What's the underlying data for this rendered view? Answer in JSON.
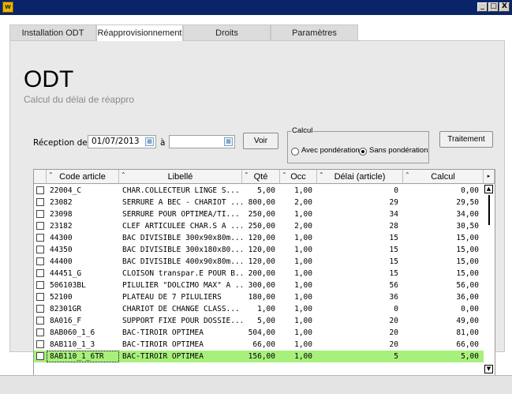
{
  "window": {
    "icon": "app-logo-icon",
    "icon_text": "W",
    "minimize": "_",
    "maximize": "□",
    "close": "X"
  },
  "tabs": [
    {
      "label": "Installation ODT",
      "active": false
    },
    {
      "label": "Réapprovisionnement",
      "active": true
    },
    {
      "label": "Droits",
      "active": false
    },
    {
      "label": "Paramètres",
      "active": false
    }
  ],
  "header": {
    "title": "ODT",
    "subtitle": "Calcul du délai de réappro"
  },
  "filters": {
    "reception_label": "Réception de",
    "date_from": "01/07/2013",
    "to_label": "à",
    "date_to": "",
    "voir_button": "Voir",
    "calcul_group_label": "Calcul",
    "option_with": "Avec pondération",
    "option_without": "Sans pondération",
    "selected_option": "without",
    "traitement_button": "Traitement"
  },
  "table": {
    "columns": [
      "Code article",
      "Libellé",
      "Qté",
      "Occ",
      "Délai (article)",
      "Calcul"
    ],
    "rows": [
      {
        "code": "22004_C",
        "libelle": "CHAR.COLLECTEUR LINGE S...",
        "qte": "5,00",
        "occ": "1,00",
        "delai": "0",
        "calcul": "0,00"
      },
      {
        "code": "23082",
        "libelle": "SERRURE A BEC - CHARIOT ...",
        "qte": "800,00",
        "occ": "2,00",
        "delai": "29",
        "calcul": "29,50"
      },
      {
        "code": "23098",
        "libelle": "SERRURE POUR OPTIMEA/TI...",
        "qte": "250,00",
        "occ": "1,00",
        "delai": "34",
        "calcul": "34,00"
      },
      {
        "code": "23182",
        "libelle": "CLEF ARTICULEE CHAR.S A ...",
        "qte": "250,00",
        "occ": "2,00",
        "delai": "28",
        "calcul": "30,50"
      },
      {
        "code": "44300",
        "libelle": "BAC DIVISIBLE 300x90x80m...",
        "qte": "120,00",
        "occ": "1,00",
        "delai": "15",
        "calcul": "15,00"
      },
      {
        "code": "44350",
        "libelle": "BAC DIVISIBLE 300x180x80...",
        "qte": "120,00",
        "occ": "1,00",
        "delai": "15",
        "calcul": "15,00"
      },
      {
        "code": "44400",
        "libelle": "BAC DIVISIBLE 400x90x80m...",
        "qte": "120,00",
        "occ": "1,00",
        "delai": "15",
        "calcul": "15,00"
      },
      {
        "code": "44451_G",
        "libelle": "CLOISON transpar.E POUR B...",
        "qte": "200,00",
        "occ": "1,00",
        "delai": "15",
        "calcul": "15,00"
      },
      {
        "code": "506103BL",
        "libelle": "PILULIER \"DOLCIMO MAX\" A ...",
        "qte": "300,00",
        "occ": "1,00",
        "delai": "56",
        "calcul": "56,00"
      },
      {
        "code": "52100",
        "libelle": "PLATEAU DE 7 PILULIERS",
        "qte": "180,00",
        "occ": "1,00",
        "delai": "36",
        "calcul": "36,00"
      },
      {
        "code": "82301GR",
        "libelle": "CHARIOT DE CHANGE CLASS...",
        "qte": "1,00",
        "occ": "1,00",
        "delai": "0",
        "calcul": "0,00"
      },
      {
        "code": "8A016_F",
        "libelle": "SUPPORT FIXE POUR DOSSIE...",
        "qte": "5,00",
        "occ": "1,00",
        "delai": "20",
        "calcul": "49,00"
      },
      {
        "code": "8AB060_1_6",
        "libelle": "BAC-TIROIR OPTIMEA",
        "qte": "504,00",
        "occ": "1,00",
        "delai": "20",
        "calcul": "81,00"
      },
      {
        "code": "8AB110_1_3",
        "libelle": "BAC-TIROIR OPTIMEA",
        "qte": "66,00",
        "occ": "1,00",
        "delai": "20",
        "calcul": "66,00"
      },
      {
        "code": "8AB110_1_6TR",
        "libelle": "BAC-TIROIR OPTIMEA",
        "qte": "156,00",
        "occ": "1,00",
        "delai": "5",
        "calcul": "5,00"
      }
    ],
    "selected_row_index": 14,
    "selected_row_color": "#a8f07c"
  },
  "icons": {
    "calendar": "calendar-icon",
    "sort": "sort-arrow-icon",
    "scroll_up": "scroll-up-arrow-icon",
    "scroll_down": "scroll-down-arrow-icon",
    "column_menu": "column-menu-icon"
  }
}
